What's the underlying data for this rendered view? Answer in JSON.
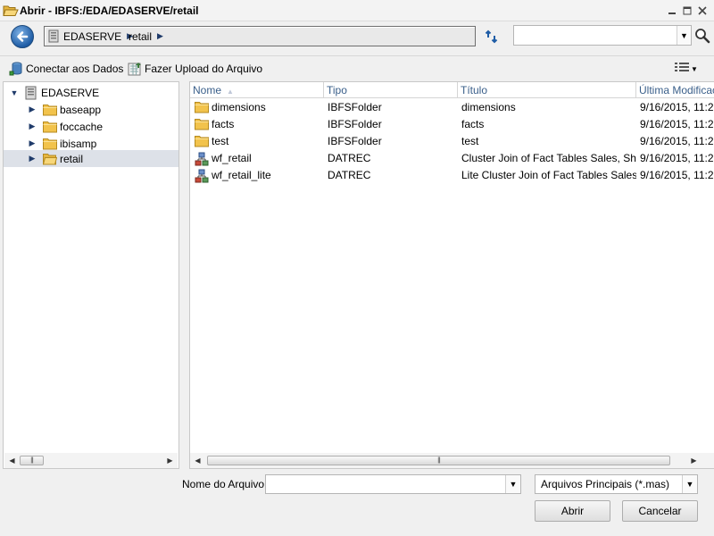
{
  "window": {
    "title": "Abrir - IBFS:/EDA/EDASERVE/retail"
  },
  "navigation": {
    "breadcrumb": [
      "EDASERVE",
      "retail"
    ],
    "search_value": ""
  },
  "toolbar": {
    "connect_label": "Conectar aos Dados",
    "upload_label": "Fazer Upload do Arquivo"
  },
  "tree": {
    "root": "EDASERVE",
    "items": [
      {
        "label": "baseapp",
        "selected": false
      },
      {
        "label": "foccache",
        "selected": false
      },
      {
        "label": "ibisamp",
        "selected": false
      },
      {
        "label": "retail",
        "selected": true
      }
    ]
  },
  "list": {
    "columns": [
      "Nome",
      "Tipo",
      "Título",
      "Última Modificação"
    ],
    "rows": [
      {
        "name": "dimensions",
        "icon": "folder-icon",
        "type": "IBFSFolder",
        "title": "dimensions",
        "modified": "9/16/2015, 11:2"
      },
      {
        "name": "facts",
        "icon": "folder-icon",
        "type": "IBFSFolder",
        "title": "facts",
        "modified": "9/16/2015, 11:2"
      },
      {
        "name": "test",
        "icon": "folder-icon",
        "type": "IBFSFolder",
        "title": "test",
        "modified": "9/16/2015, 11:2"
      },
      {
        "name": "wf_retail",
        "icon": "cluster-synonym-icon",
        "type": "DATREC",
        "title": "Cluster Join of Fact Tables Sales, Shipme",
        "modified": "9/16/2015, 11:2"
      },
      {
        "name": "wf_retail_lite",
        "icon": "cluster-synonym-icon",
        "type": "DATREC",
        "title": "Lite Cluster Join of Fact Tables Sales and",
        "modified": "9/16/2015, 11:2"
      }
    ]
  },
  "footer": {
    "filename_label": "Nome do Arquivo:",
    "filename_value": "",
    "filter_value": "Arquivos Principais (*.mas)",
    "open_label": "Abrir",
    "cancel_label": "Cancelar"
  },
  "colors": {
    "selection": "#dde1e8",
    "header_text": "#3a5f8a",
    "back_button": "#1f5da6",
    "folder": "#f2c34c"
  }
}
